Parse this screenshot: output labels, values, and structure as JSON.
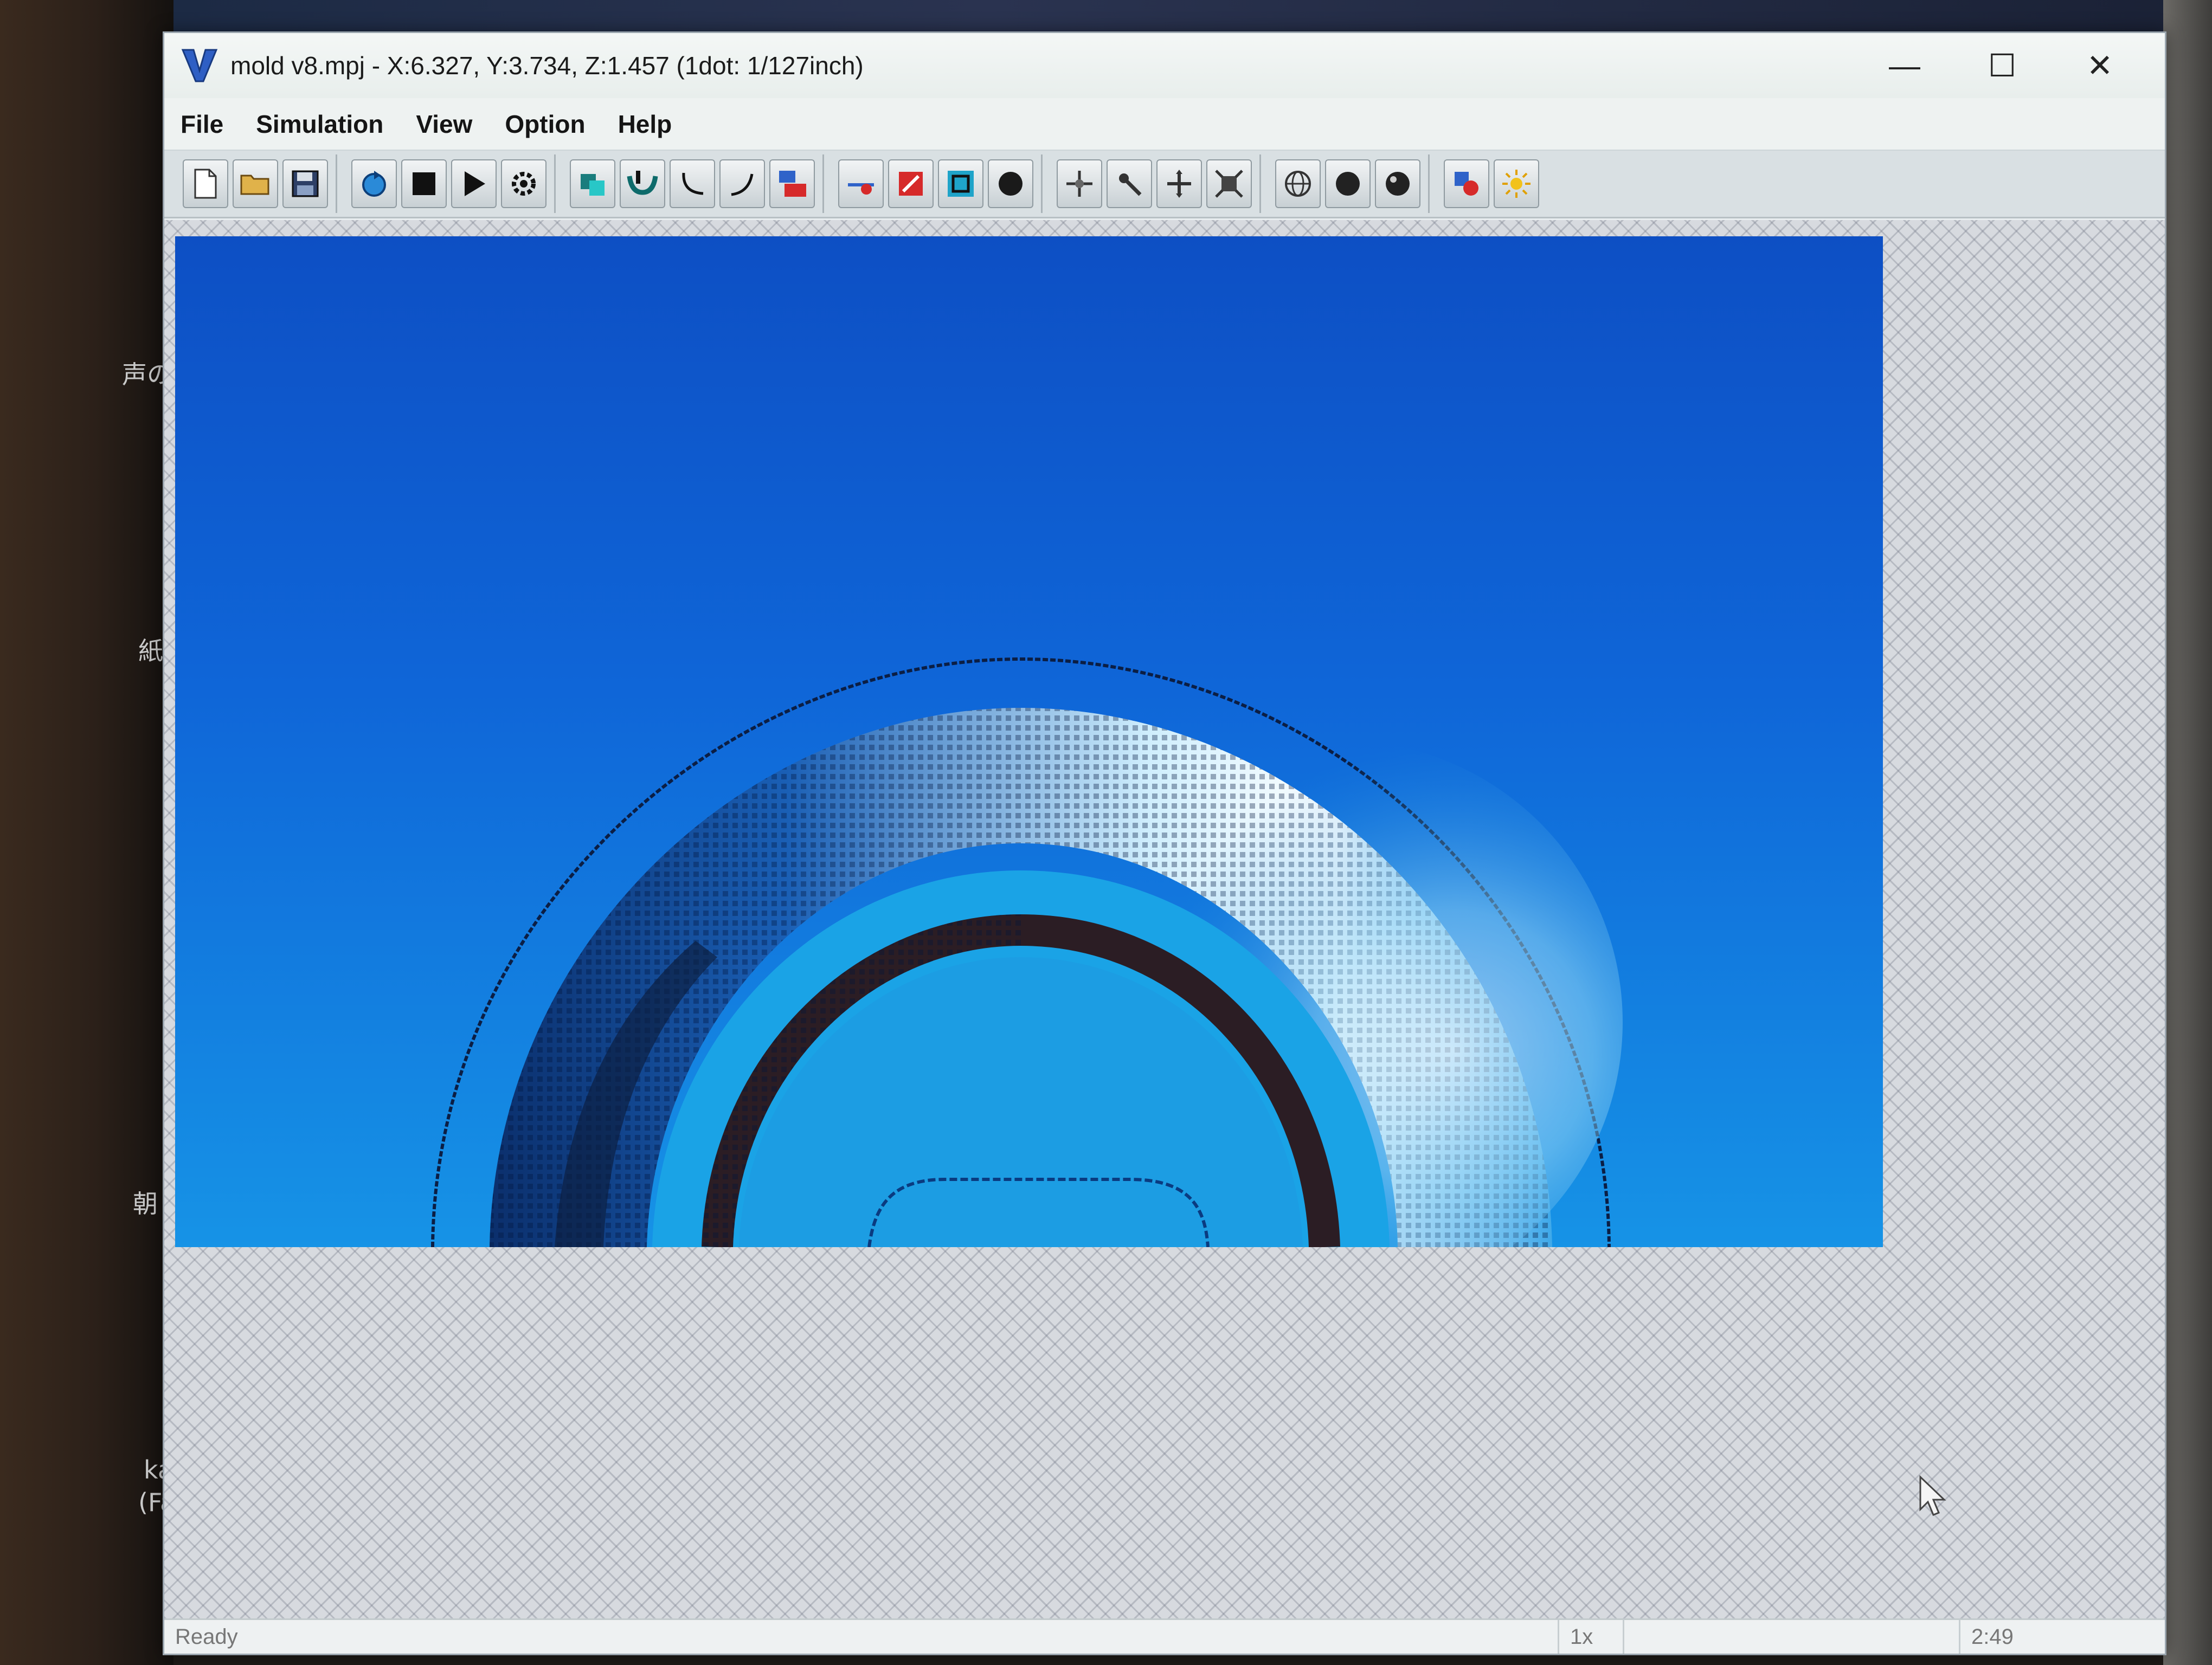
{
  "window": {
    "title": "mold v8.mpj - X:6.327, Y:3.734, Z:1.457 (1dot: 1/127inch)",
    "controls": {
      "minimize": "—",
      "maximize": "☐",
      "close": "✕"
    }
  },
  "menu": [
    {
      "label": "File"
    },
    {
      "label": "Simulation"
    },
    {
      "label": "View"
    },
    {
      "label": "Option"
    },
    {
      "label": "Help"
    }
  ],
  "toolbar": {
    "groups": [
      [
        "new-file",
        "open-file",
        "save-file"
      ],
      [
        "reload",
        "stop",
        "play",
        "settings"
      ],
      [
        "mesh-view",
        "tool-path",
        "curve-path",
        "arc-path",
        "3d-view"
      ],
      [
        "sim-run",
        "color-map",
        "frame-view",
        "shaded-sphere"
      ],
      [
        "move-tool",
        "rotate-tool",
        "pan-tool",
        "fit-view"
      ],
      [
        "wire-sphere",
        "solid-sphere",
        "gloss-sphere"
      ],
      [
        "layer-color",
        "light-source"
      ]
    ]
  },
  "status": {
    "left": "Ready",
    "speed": "1x",
    "time": "2:49"
  },
  "desktop": {
    "side_labels": [
      "声の",
      "紙",
      "朝",
      "ka",
      "(Fa"
    ]
  },
  "colors": {
    "render_top": "#0d4fc4",
    "render_bottom": "#1693e6",
    "dark_ring": "#2b1d24",
    "highlight": "#e9f7ff"
  }
}
